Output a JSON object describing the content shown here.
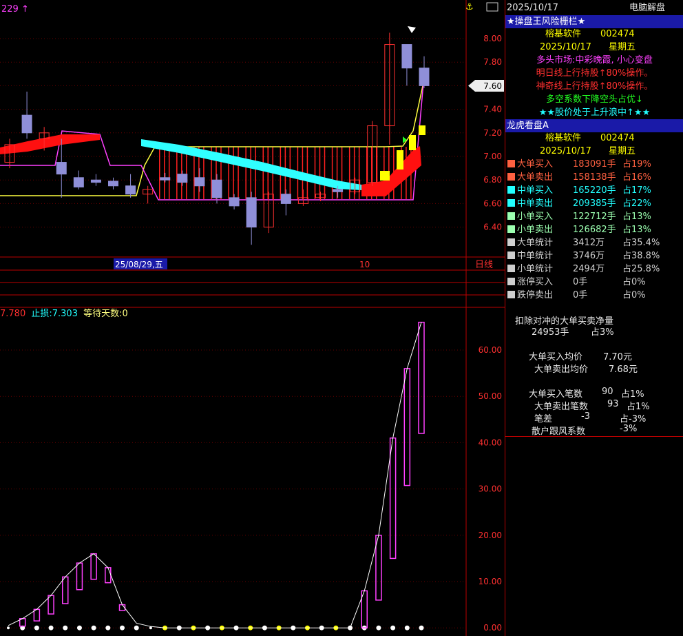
{
  "top_left_label": "229",
  "top_icon": "anchor-icon",
  "price_axis": {
    "ticks": [
      "8.00",
      "7.80",
      "7.60",
      "7.40",
      "7.20",
      "7.00",
      "6.80",
      "6.60",
      "6.40"
    ],
    "current": "7.60"
  },
  "time_axis": {
    "date_label": "25/08/29,五",
    "month_label": "10",
    "period": "日线"
  },
  "indicator_bar": {
    "val1": "7.780",
    "stop_label": "止损:",
    "stop_val": "7.303",
    "wait_label": "等待天数:",
    "wait_val": "0"
  },
  "lower_axis": {
    "ticks": [
      "60.00",
      "50.00",
      "40.00",
      "30.00",
      "20.00",
      "10.00",
      "0.00"
    ]
  },
  "panel": {
    "date": "2025/10/17",
    "title_right": "电脑解盘",
    "section1": "★操盘王风险栅栏★",
    "brand": "榕基软件",
    "code": "002474",
    "date2": "2025/10/17",
    "weekday": "星期五",
    "line1": "多头市场:中彩晚霞, 小心变盘",
    "line2": "明日线上行持股↑80%操作。",
    "line3": "神奇线上行持股↑80%操作。",
    "line4": "多空系数下降空头占优↓",
    "line5": "★★股价处于上升浪中↑★★",
    "section2": "龙虎看盘A",
    "rows": [
      {
        "label": "大单买入",
        "value": "183091手",
        "pct": "占19%",
        "color": "#ff6040"
      },
      {
        "label": "大单卖出",
        "value": "158138手",
        "pct": "占16%",
        "color": "#ff6040"
      },
      {
        "label": "中单买入",
        "value": "165220手",
        "pct": "占17%",
        "color": "#22ffff"
      },
      {
        "label": "中单卖出",
        "value": "209385手",
        "pct": "占22%",
        "color": "#22ffff"
      },
      {
        "label": "小单买入",
        "value": "122712手",
        "pct": "占13%",
        "color": "#9cffb0"
      },
      {
        "label": "小单卖出",
        "value": "126682手",
        "pct": "占13%",
        "color": "#9cffb0"
      },
      {
        "label": "大单统计",
        "value": "3412万",
        "pct": "占35.4%",
        "color": "#cfcfcf"
      },
      {
        "label": "中单统计",
        "value": "3746万",
        "pct": "占38.8%",
        "color": "#cfcfcf"
      },
      {
        "label": "小单统计",
        "value": "2494万",
        "pct": "占25.8%",
        "color": "#cfcfcf"
      },
      {
        "label": "涨停买入",
        "value": "0手",
        "pct": "占0%",
        "color": "#cfcfcf"
      },
      {
        "label": "跌停卖出",
        "value": "0手",
        "pct": "占0%",
        "color": "#cfcfcf"
      }
    ],
    "net_title": "扣除对冲的大单买卖净量",
    "net_value": "24953手",
    "net_pct": "占3%",
    "buy_avg_label": "大单买入均价",
    "buy_avg": "7.70元",
    "sell_avg_label": "大单卖出均价",
    "sell_avg": "7.68元",
    "buy_cnt_label": "大单买入笔数",
    "buy_cnt": "90",
    "buy_cnt_pct": "占1%",
    "sell_cnt_label": "大单卖出笔数",
    "sell_cnt": "93",
    "sell_cnt_pct": "占1%",
    "diff_label": "笔差",
    "diff": "-3",
    "diff_pct": "占-3%",
    "retail_label": "散户跟风系数",
    "retail": "-3%"
  },
  "chart_data": [
    {
      "type": "candlestick",
      "ylim": [
        6.2,
        8.1
      ],
      "candles": [
        {
          "o": 6.95,
          "h": 7.15,
          "l": 6.9,
          "c": 7.1
        },
        {
          "o": 7.35,
          "h": 7.55,
          "l": 7.15,
          "c": 7.2
        },
        {
          "o": 7.15,
          "h": 7.25,
          "l": 7.05,
          "c": 7.2
        },
        {
          "o": 6.95,
          "h": 7.15,
          "l": 6.65,
          "c": 6.85
        },
        {
          "o": 6.82,
          "h": 6.88,
          "l": 6.72,
          "c": 6.74
        },
        {
          "o": 6.8,
          "h": 6.85,
          "l": 6.75,
          "c": 6.78
        },
        {
          "o": 6.79,
          "h": 6.82,
          "l": 6.72,
          "c": 6.75
        },
        {
          "o": 6.75,
          "h": 6.85,
          "l": 6.65,
          "c": 6.68
        },
        {
          "o": 6.68,
          "h": 6.75,
          "l": 6.6,
          "c": 6.72
        },
        {
          "o": 6.82,
          "h": 6.86,
          "l": 6.78,
          "c": 6.8
        },
        {
          "o": 6.85,
          "h": 6.88,
          "l": 6.75,
          "c": 6.78
        },
        {
          "o": 6.82,
          "h": 6.9,
          "l": 6.7,
          "c": 6.75
        },
        {
          "o": 6.8,
          "h": 6.85,
          "l": 6.6,
          "c": 6.65
        },
        {
          "o": 6.65,
          "h": 6.68,
          "l": 6.55,
          "c": 6.58
        },
        {
          "o": 6.65,
          "h": 6.7,
          "l": 6.25,
          "c": 6.4
        },
        {
          "o": 6.4,
          "h": 6.7,
          "l": 6.35,
          "c": 6.68
        },
        {
          "o": 6.68,
          "h": 6.72,
          "l": 6.5,
          "c": 6.6
        },
        {
          "o": 6.6,
          "h": 6.72,
          "l": 6.58,
          "c": 6.65
        },
        {
          "o": 6.65,
          "h": 6.7,
          "l": 6.62,
          "c": 6.68
        },
        {
          "o": 6.72,
          "h": 6.75,
          "l": 6.65,
          "c": 6.7
        },
        {
          "o": 6.7,
          "h": 6.82,
          "l": 6.68,
          "c": 6.8
        },
        {
          "o": 6.78,
          "h": 7.3,
          "l": 6.75,
          "c": 7.26
        },
        {
          "o": 7.26,
          "h": 8.05,
          "l": 7.1,
          "c": 7.95
        },
        {
          "o": 7.95,
          "h": 7.95,
          "l": 7.6,
          "c": 7.75
        },
        {
          "o": 7.75,
          "h": 7.85,
          "l": 7.58,
          "c": 7.6
        }
      ]
    },
    {
      "type": "bar",
      "ylim": [
        0,
        66
      ],
      "values": [
        0.5,
        2,
        4,
        7,
        11,
        14,
        16,
        13,
        5,
        1,
        0.3,
        0,
        0,
        0,
        0,
        0,
        0,
        0,
        0,
        0,
        0,
        0,
        0,
        0,
        0,
        8,
        20,
        41,
        56,
        66
      ]
    }
  ]
}
